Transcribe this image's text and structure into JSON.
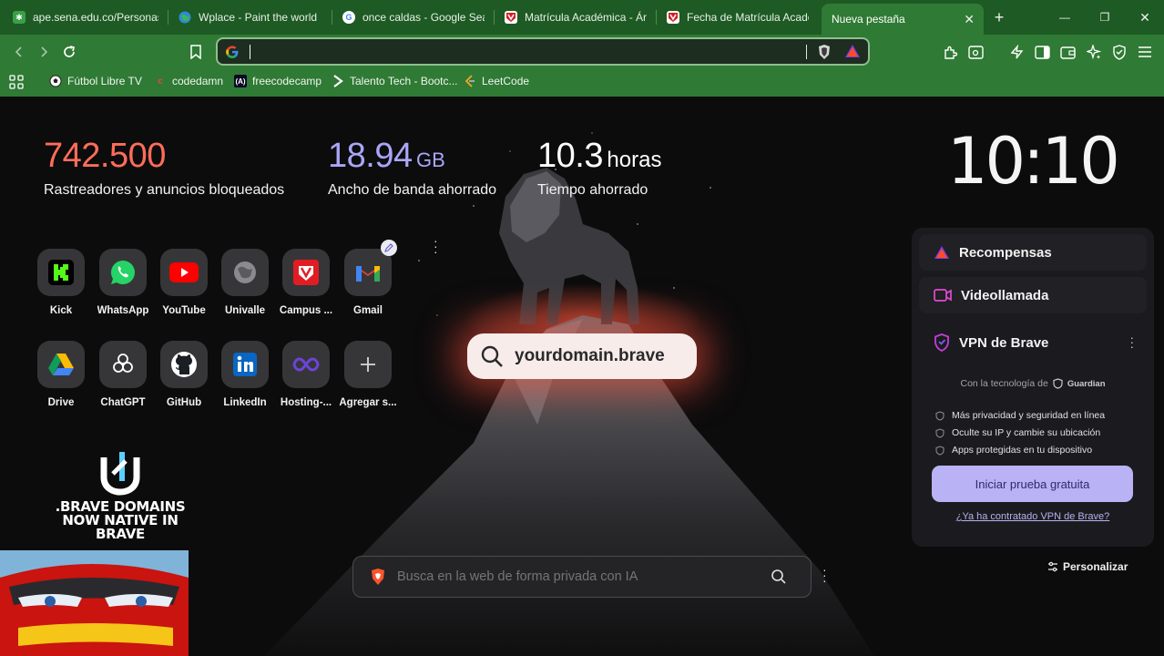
{
  "tabs": [
    {
      "title": "ape.sena.edu.co/Personas/T",
      "icon": "sena-icon"
    },
    {
      "title": "Wplace - Paint the world",
      "icon": "globe-icon"
    },
    {
      "title": "once caldas - Google Search",
      "icon": "google-icon"
    },
    {
      "title": "Matrícula Académica - Área",
      "icon": "univalle-icon"
    },
    {
      "title": "Fecha de Matrícula Académica",
      "icon": "univalle-icon"
    },
    {
      "title": "Nueva pestaña",
      "icon": "none",
      "active": true
    }
  ],
  "window_controls": {
    "new_tab": "+",
    "minimize": "—",
    "maximize": "❐",
    "close": "✕"
  },
  "omnibox": {
    "value": "",
    "placeholder": ""
  },
  "bookmarks": [
    {
      "label": "Fútbol Libre TV",
      "icon": "soccer-icon"
    },
    {
      "label": "codedamn",
      "icon": "codedamn-icon"
    },
    {
      "label": "freecodecamp",
      "icon": "freecodecamp-icon"
    },
    {
      "label": "Talento Tech - Bootc...",
      "icon": "chevron-icon"
    },
    {
      "label": "LeetCode",
      "icon": "leetcode-icon"
    }
  ],
  "stats": {
    "trackers": {
      "value": "742.500",
      "label": "Rastreadores y anuncios bloqueados",
      "color": "#ff6d5a"
    },
    "bandwidth": {
      "value": "18.94",
      "unit": "GB",
      "label": "Ancho de banda ahorrado",
      "color": "#a9a6f7"
    },
    "time": {
      "value": "10.3",
      "unit": "horas",
      "label": "Tiempo ahorrado",
      "color": "#ffffff"
    }
  },
  "clock": "10:10",
  "top_sites": [
    {
      "label": "Kick",
      "icon": "kick-icon"
    },
    {
      "label": "WhatsApp",
      "icon": "whatsapp-icon"
    },
    {
      "label": "YouTube",
      "icon": "youtube-icon"
    },
    {
      "label": "Univalle",
      "icon": "globe-icon"
    },
    {
      "label": "Campus ...",
      "icon": "campus-icon"
    },
    {
      "label": "Gmail",
      "icon": "gmail-icon"
    },
    {
      "label": "Drive",
      "icon": "drive-icon"
    },
    {
      "label": "ChatGPT",
      "icon": "chatgpt-icon"
    },
    {
      "label": "GitHub",
      "icon": "github-icon"
    },
    {
      "label": "LinkedIn",
      "icon": "linkedin-icon"
    },
    {
      "label": "Hosting-...",
      "icon": "hosting-icon"
    },
    {
      "label": "Agregar s...",
      "icon": "plus-icon"
    }
  ],
  "domain_pill": "yourdomain.brave",
  "promo": ".BRAVE DOMAINS\nNOW NATIVE IN\nBRAVE",
  "search": {
    "placeholder": "Busca en la web de forma privada con IA"
  },
  "panel": {
    "rewards": "Recompensas",
    "videocall": "Videollamada",
    "vpn_title": "VPN de Brave",
    "powered_by": "Con la tecnología de",
    "guardian": "Guardian",
    "features": [
      "Más privacidad y seguridad en línea",
      "Oculte su IP y cambie su ubicación",
      "Apps protegidas en tu dispositivo"
    ],
    "trial_button": "Iniciar prueba gratuita",
    "already_have": "¿Ya ha contratado VPN de Brave?"
  },
  "customize": "Personalizar"
}
